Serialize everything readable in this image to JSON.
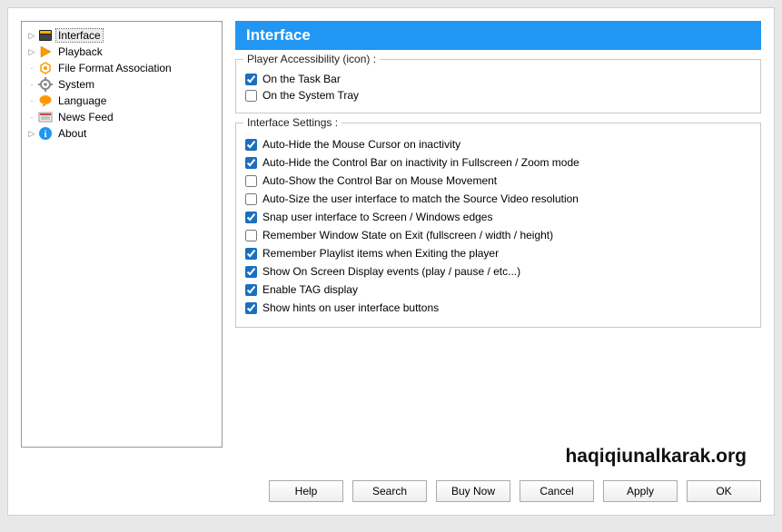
{
  "header": {
    "title": "Interface"
  },
  "tree": {
    "items": [
      {
        "label": "Interface",
        "icon": "interface",
        "expander": "closed",
        "selected": true
      },
      {
        "label": "Playback",
        "icon": "playback",
        "expander": "closed",
        "selected": false
      },
      {
        "label": "File Format Association",
        "icon": "assoc",
        "expander": "empty",
        "selected": false
      },
      {
        "label": "System",
        "icon": "system",
        "expander": "empty",
        "selected": false
      },
      {
        "label": "Language",
        "icon": "language",
        "expander": "empty",
        "selected": false
      },
      {
        "label": "News Feed",
        "icon": "news",
        "expander": "empty",
        "selected": false
      },
      {
        "label": "About",
        "icon": "about",
        "expander": "closed",
        "selected": false
      }
    ]
  },
  "group_accessibility": {
    "legend": "Player Accessibility (icon) :",
    "options": [
      {
        "label": "On the Task Bar",
        "checked": true
      },
      {
        "label": "On the System Tray",
        "checked": false
      }
    ]
  },
  "group_settings": {
    "legend": "Interface Settings :",
    "options": [
      {
        "label": "Auto-Hide the Mouse Cursor on inactivity",
        "checked": true
      },
      {
        "label": "Auto-Hide the Control Bar on inactivity in Fullscreen / Zoom mode",
        "checked": true
      },
      {
        "label": "Auto-Show the Control Bar on Mouse Movement",
        "checked": false
      },
      {
        "label": "Auto-Size the user interface to match the Source Video resolution",
        "checked": false
      },
      {
        "label": "Snap user interface to Screen / Windows edges",
        "checked": true
      },
      {
        "label": "Remember Window State on Exit (fullscreen / width / height)",
        "checked": false
      },
      {
        "label": "Remember Playlist items when Exiting the player",
        "checked": true
      },
      {
        "label": "Show On Screen Display events (play / pause / etc...)",
        "checked": true
      },
      {
        "label": "Enable TAG display",
        "checked": true
      },
      {
        "label": "Show hints on user interface buttons",
        "checked": true
      }
    ]
  },
  "buttons": {
    "help": "Help",
    "search": "Search",
    "buynow": "Buy Now",
    "cancel": "Cancel",
    "apply": "Apply",
    "ok": "OK"
  },
  "watermark": "haqiqiunalkarak.org"
}
